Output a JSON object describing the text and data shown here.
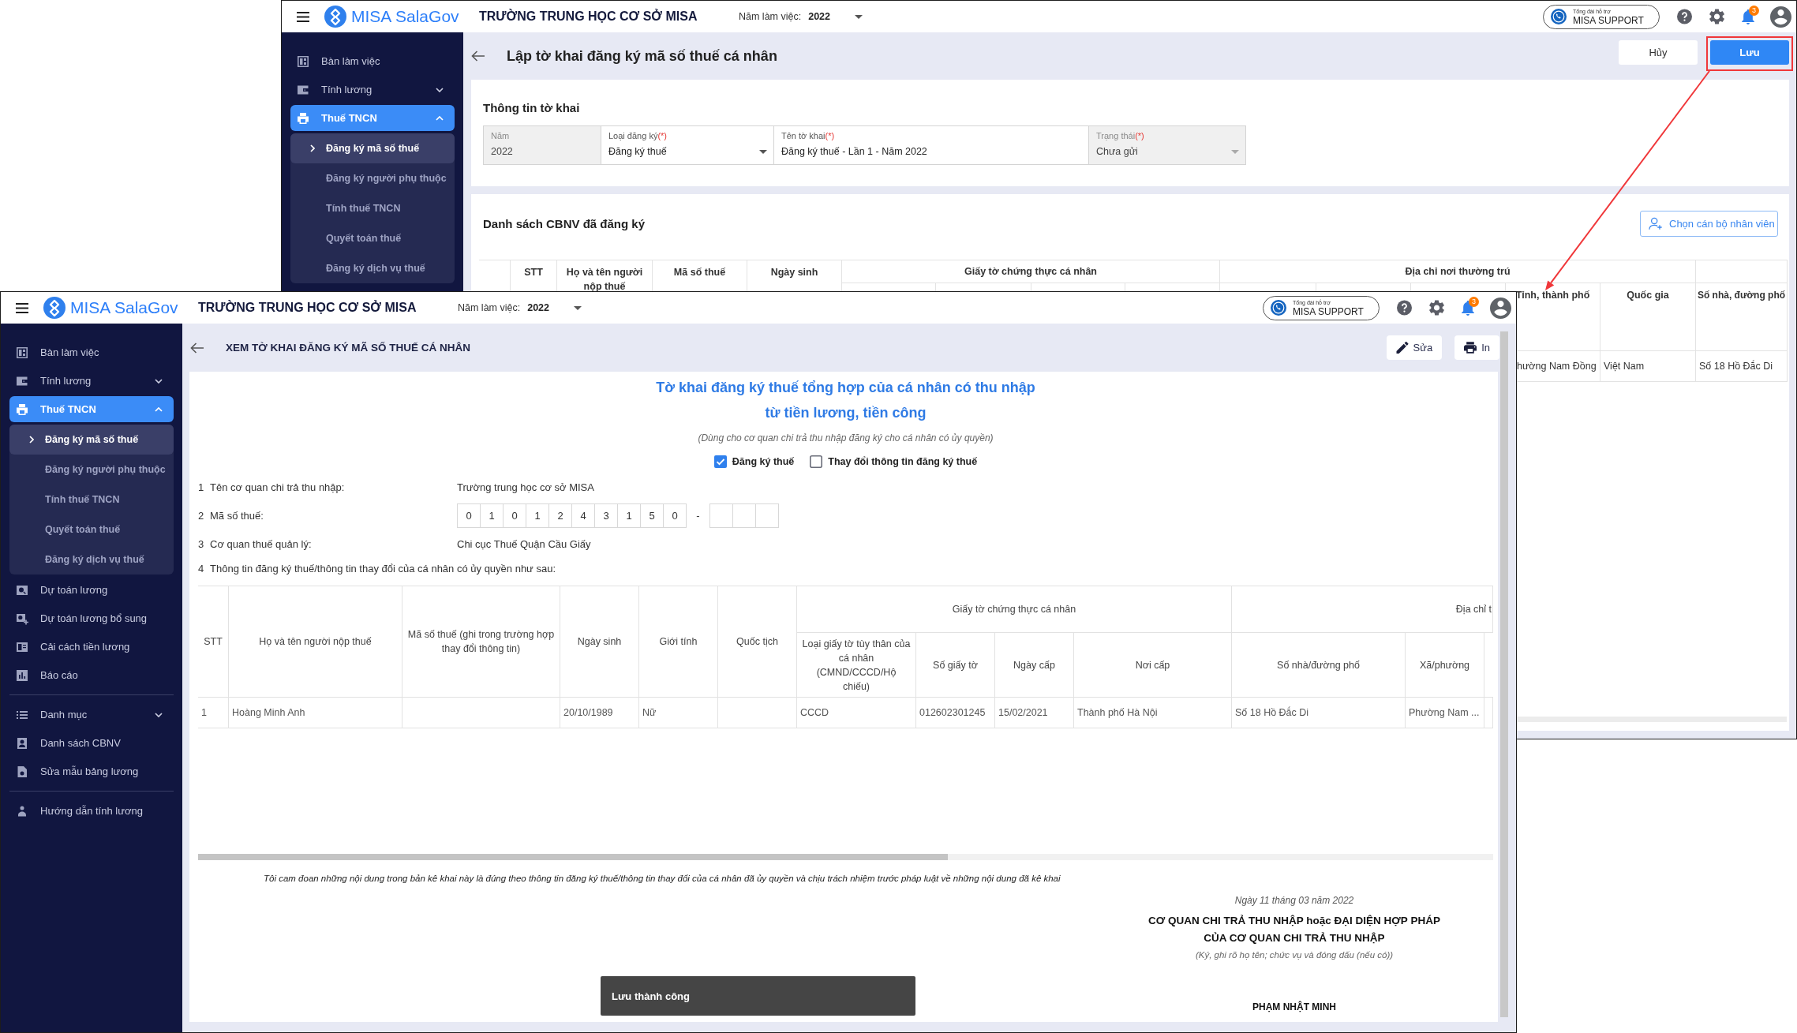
{
  "back_window": {
    "header": {
      "app_name": "MISA SalaGov",
      "org_name": "TRƯỜNG TRUNG HỌC CƠ SỞ MISA",
      "year_label": "Năm làm việc:",
      "year": "2022",
      "support": {
        "caption": "Tổng đài hỗ trợ",
        "label": "MISA SUPPORT"
      },
      "notification_count": "3"
    },
    "sidebar": {
      "items": [
        {
          "label": "Bàn làm việc",
          "selected": false
        },
        {
          "label": "Tính lương",
          "selected": false,
          "expanded": false
        },
        {
          "label": "Thuế TNCN",
          "selected": true,
          "expanded": true,
          "children": [
            {
              "label": "Đăng ký mã số thuế",
              "selected": true
            },
            {
              "label": "Đăng ký người phụ thuộc",
              "selected": false
            },
            {
              "label": "Tính thuế TNCN",
              "selected": false
            },
            {
              "label": "Quyết toán thuế",
              "selected": false
            },
            {
              "label": "Đăng ký dịch vụ thuế",
              "selected": false
            }
          ]
        }
      ]
    },
    "page_title": "Lập tờ khai đăng ký mã số thuế cá nhân",
    "buttons": [
      {
        "label": "Hủy",
        "kind": "secondary",
        "highlighted": false
      },
      {
        "label": "Lưu",
        "kind": "primary",
        "highlighted": true
      }
    ],
    "info_section": {
      "title": "Thông tin tờ khai",
      "fields": [
        {
          "label": "Năm",
          "value": "2022",
          "kind": "text",
          "disabled": true
        },
        {
          "label": "Loại đăng ký",
          "required_mark": "(*)",
          "value": "Đăng ký thuế",
          "kind": "dropdown",
          "disabled": false
        },
        {
          "label": "Tên tờ khai",
          "required_mark": "(*)",
          "value": "Đăng ký thuế - Lần 1 - Năm 2022",
          "kind": "text",
          "disabled": false
        },
        {
          "label": "Trạng thái",
          "required_mark": "(*)",
          "value": "Chưa gửi",
          "kind": "dropdown",
          "disabled": true
        }
      ]
    },
    "list_section": {
      "title": "Danh sách CBNV đã đăng ký",
      "add_button": "Chọn cán bộ nhân viên",
      "table": {
        "column_groups": [
          {
            "header": "Giấy tờ chứng thực cá nhân"
          },
          {
            "header": "Địa chỉ nơi thường trú"
          }
        ],
        "columns": [
          {
            "header": "STT"
          },
          {
            "header": "Họ và tên người nộp thuế"
          },
          {
            "header": "Mã số thuế"
          },
          {
            "header": "Ngày sinh"
          },
          {
            "header": "Tỉnh, thành phố"
          },
          {
            "header": "Quốc gia"
          },
          {
            "header": "Số nhà, đường phố"
          }
        ],
        "rows": [
          {
            "cells": [
              null,
              null,
              null,
              null,
              "hường Nam Đồng",
              "Việt Nam",
              "Số 18 Hồ Đắc Di"
            ]
          }
        ]
      }
    }
  },
  "front_window": {
    "header": {
      "app_name": "MISA SalaGov",
      "org_name": "TRƯỜNG TRUNG HỌC CƠ SỞ MISA",
      "year_label": "Năm làm việc:",
      "year": "2022",
      "support": {
        "caption": "Tổng đài hỗ trợ",
        "label": "MISA SUPPORT"
      },
      "notification_count": "3"
    },
    "sidebar": {
      "sections": [
        {
          "items": [
            {
              "label": "Bàn làm việc",
              "selected": false
            },
            {
              "label": "Tính lương",
              "selected": false,
              "expanded": false
            },
            {
              "label": "Thuế TNCN",
              "selected": true,
              "expanded": true,
              "children": [
                {
                  "label": "Đăng ký mã số thuế",
                  "selected": true
                },
                {
                  "label": "Đăng ký người phụ thuộc",
                  "selected": false
                },
                {
                  "label": "Tính thuế TNCN",
                  "selected": false
                },
                {
                  "label": "Quyết toán thuế",
                  "selected": false
                },
                {
                  "label": "Đăng ký dịch vụ thuế",
                  "selected": false
                }
              ]
            },
            {
              "label": "Dự toán lương",
              "selected": false
            },
            {
              "label": "Dự toán lương bổ sung",
              "selected": false
            },
            {
              "label": "Cải cách tiền lương",
              "selected": false
            },
            {
              "label": "Báo cáo",
              "selected": false
            }
          ]
        },
        {
          "items": [
            {
              "label": "Danh mục",
              "selected": false,
              "expanded": false
            },
            {
              "label": "Danh sách CBNV",
              "selected": false
            },
            {
              "label": "Sửa mẫu bảng lương",
              "selected": false
            }
          ]
        },
        {
          "items": [
            {
              "label": "Hướng dẫn tính lương",
              "selected": false
            }
          ]
        }
      ]
    },
    "page_title": "XEM TỜ KHAI ĐĂNG KÝ MÃ SỐ THUẾ CÁ NHÂN",
    "toolbar": [
      {
        "label": "Sửa"
      },
      {
        "label": "In"
      }
    ],
    "document": {
      "title_lines": [
        "Tờ khai đăng ký thuế tổng hợp của cá nhân có thu nhập",
        "từ tiền lương, tiền công"
      ],
      "subtitle": "(Dùng cho cơ quan chi trả thu nhập đăng ký cho cá nhân có ủy quyền)",
      "options": [
        {
          "label": "Đăng ký thuế",
          "checked": true
        },
        {
          "label": "Thay đổi thông tin đăng ký thuế",
          "checked": false
        }
      ],
      "items": [
        {
          "number": "1",
          "label": "Tên cơ quan chi trả thu nhập:",
          "kind": "value",
          "value": "Trường trung học cơ sở MISA"
        },
        {
          "number": "2",
          "label": "Mã số thuế:",
          "kind": "boxes",
          "digits": [
            "0",
            "1",
            "0",
            "1",
            "2",
            "4",
            "3",
            "1",
            "5",
            "0"
          ],
          "separator": "-"
        },
        {
          "number": "3",
          "label": "Cơ quan thuế quản lý:",
          "kind": "value",
          "value": "Chi cục Thuế Quận Cầu Giấy"
        },
        {
          "number": "4",
          "label": "Thông tin đăng ký thuế/thông tin thay đổi của cá nhân có ủy quyền như sau:",
          "kind": "plain"
        }
      ],
      "table": {
        "column_groups": [
          {
            "header": "Giấy tờ chứng thực cá nhân"
          },
          {
            "header": "Địa chỉ t"
          }
        ],
        "columns": [
          {
            "header": "STT"
          },
          {
            "header": "Họ và tên người nộp thuế"
          },
          {
            "header": "Mã số thuế (ghi trong trường hợp thay đổi thông tin)"
          },
          {
            "header": "Ngày sinh"
          },
          {
            "header": "Giới tính"
          },
          {
            "header": "Quốc tịch"
          },
          {
            "header": "Loại giấy tờ tùy thân của cá nhân (CMND/CCCD/Hộ chiếu)"
          },
          {
            "header": "Số giấy tờ"
          },
          {
            "header": "Ngày cấp"
          },
          {
            "header": "Nơi cấp"
          },
          {
            "header": "Số nhà/đường phố"
          },
          {
            "header": "Xã/phường"
          }
        ],
        "rows": [
          {
            "cells": [
              "1",
              "Hoàng Minh Anh",
              null,
              "20/10/1989",
              "Nữ",
              null,
              "CCCD",
              "012602301245",
              "15/02/2021",
              "Thành phố Hà Nội",
              "Số 18 Hồ Đắc Di",
              "Phường Nam ..."
            ]
          }
        ]
      },
      "declaration": "Tôi cam đoan những nội dung trong bản kê khai này là đúng theo thông tin đăng ký thuế/thông tin thay đổi của cá nhân đã ủy quyền và chịu trách nhiệm trước pháp luật về những nội dung đã kê khai",
      "signature": {
        "date": "Ngày 11 tháng 03 năm 2022",
        "title_lines": [
          "CƠ QUAN CHI TRẢ THU NHẬP hoặc ĐẠI DIỆN HỢP PHÁP",
          "CỦA CƠ QUAN CHI TRẢ THU NHẬP"
        ],
        "note": "(Ký, ghi rõ họ tên; chức vụ và đóng dấu (nếu có))",
        "name": "PHẠM NHẬT MINH"
      }
    },
    "toast": "Lưu thành công"
  }
}
